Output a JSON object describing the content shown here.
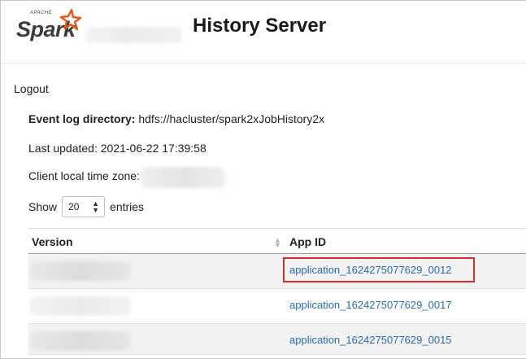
{
  "header": {
    "logo_brand": "Spark",
    "logo_apache": "APACHE",
    "title": "History Server"
  },
  "nav": {
    "logout": "Logout"
  },
  "info": {
    "event_log_label": "Event log directory:",
    "event_log_value": "hdfs://hacluster/spark2xJobHistory2x",
    "last_updated_label": "Last updated:",
    "last_updated_value": "2021-06-22 17:39:58",
    "timezone_label": "Client local time zone:"
  },
  "length_control": {
    "prefix": "Show",
    "selected": "20",
    "suffix": "entries"
  },
  "table": {
    "columns": [
      "Version",
      "App ID"
    ],
    "rows": [
      {
        "version": "",
        "app_id": "application_1624275077629_0012",
        "highlighted": true
      },
      {
        "version": "",
        "app_id": "application_1624275077629_0017",
        "highlighted": false
      },
      {
        "version": "",
        "app_id": "application_1624275077629_0015",
        "highlighted": false
      }
    ]
  },
  "colors": {
    "link": "#2a6cb0",
    "highlight_border": "#d22f2f",
    "logo_star": "#e25a1c",
    "odd_row": "#f2f2f2"
  }
}
